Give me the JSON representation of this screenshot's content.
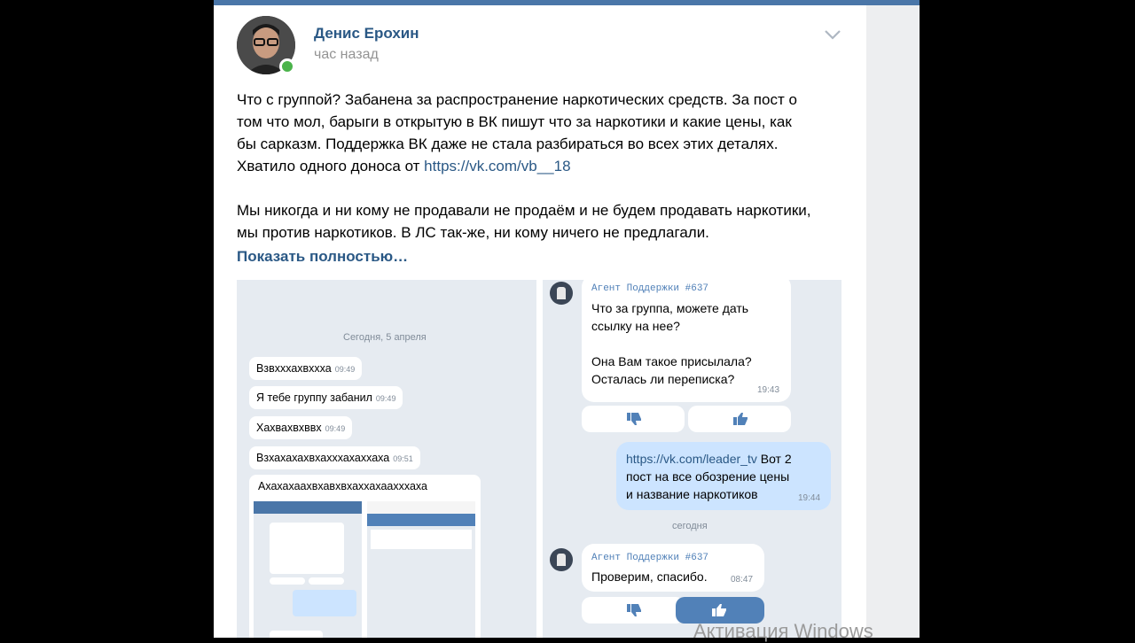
{
  "post": {
    "author": "Денис Ерохин",
    "time": "час назад",
    "text_lines": [
      "Что с группой? Забанена за распространение наркотических средств. За пост о",
      "том что мол, барыги в открытую в ВК пишут что за наркотики и какие цены, как",
      "бы сарказм. Поддержка ВК даже не стала разбираться во всех этих деталях."
    ],
    "line4_prefix": "Хватило одного доноса от ",
    "line4_link": "https://vk.com/vb__18",
    "para2_lines": [
      "Мы никогда и ни кому не продавали не продаём и не будем продавать наркотики,",
      "мы против наркотиков. В ЛС так-же, ни кому ничего не предлагали."
    ],
    "show_more": "Показать полностью…"
  },
  "left_chat": {
    "date": "Сегодня, 5 апреля",
    "messages": [
      {
        "text": "Взвхххахвххха",
        "time": "09:49"
      },
      {
        "text": "Я тебе группу забанил",
        "time": "09:49"
      },
      {
        "text": "Хахвахвхввх",
        "time": "09:49"
      },
      {
        "text": "Взхахахахвхахххахаххаха",
        "time": "09:51"
      }
    ],
    "image_caption": "Ахахахаахвхавхвхаххахаахххаха"
  },
  "right_chat": {
    "agent_name": "Агент Поддержки #637",
    "msg1_lines": [
      "Что за группа, можете дать",
      "ссылку на нее?",
      "",
      "Она Вам такое присылала?",
      "Осталась ли переписка?"
    ],
    "msg1_time": "19:43",
    "my_link": "https://vk.com/leader_tv",
    "my_line1_rest": " Вот 2",
    "my_line2": "пост на все обозрение цены",
    "my_line3": "и название наркотиков",
    "my_time": "19:44",
    "date2": "сегодня",
    "agent_name2": "Агент Поддержки #637",
    "msg2": "Проверим, спасибо.",
    "msg2_time": "08:47"
  },
  "watermark": "Активация Windows",
  "colors": {
    "link": "#2a5885",
    "accent": "#4a76a8",
    "online": "#4bb34b",
    "chat_bg": "#e6ebf1",
    "my_bubble": "#cce4ff"
  }
}
